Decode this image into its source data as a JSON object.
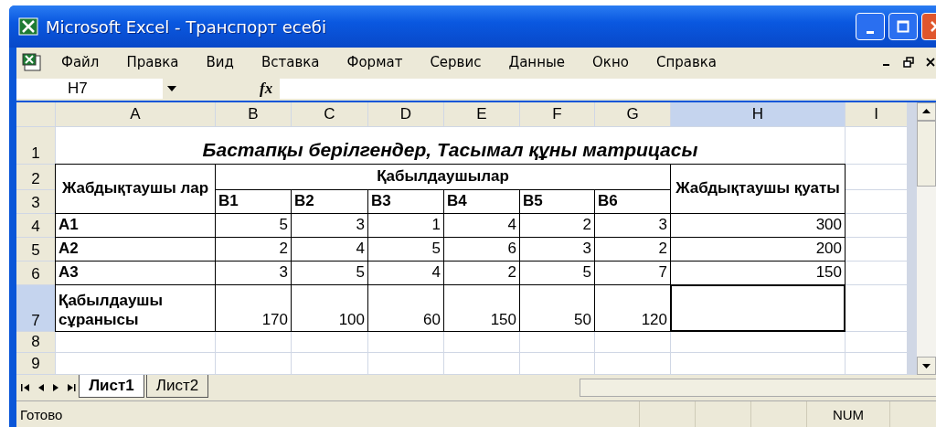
{
  "window": {
    "title": "Microsoft Excel - Транспорт есебі"
  },
  "menu": [
    "Файл",
    "Правка",
    "Вид",
    "Вставка",
    "Формат",
    "Сервис",
    "Данные",
    "Окно",
    "Справка"
  ],
  "formula_bar": {
    "name_box": "H7",
    "fx_label": "fx"
  },
  "column_headers": [
    {
      "label": "A",
      "selected": false
    },
    {
      "label": "B",
      "selected": false
    },
    {
      "label": "C",
      "selected": false
    },
    {
      "label": "D",
      "selected": false
    },
    {
      "label": "E",
      "selected": false
    },
    {
      "label": "F",
      "selected": false
    },
    {
      "label": "G",
      "selected": false
    },
    {
      "label": "H",
      "selected": true
    },
    {
      "label": "I",
      "selected": false
    }
  ],
  "row_headers": [
    {
      "label": "1",
      "selected": false
    },
    {
      "label": "2",
      "selected": false
    },
    {
      "label": "3",
      "selected": false
    },
    {
      "label": "4",
      "selected": false
    },
    {
      "label": "5",
      "selected": false
    },
    {
      "label": "6",
      "selected": false
    },
    {
      "label": "7",
      "selected": true
    },
    {
      "label": "8",
      "selected": false
    },
    {
      "label": "9",
      "selected": false
    }
  ],
  "table": {
    "title": "Бастапқы берілгендер, Тасымал құны матрицасы",
    "supplier_header": "Жабдықтаушы лар",
    "receivers_header": "Қабылдаушылар",
    "capacity_header": "Жабдықтаушы қуаты",
    "receivers": [
      "B1",
      "B2",
      "B3",
      "B4",
      "B5",
      "B6"
    ],
    "suppliers": [
      {
        "name": "A1",
        "costs": [
          "5",
          "3",
          "1",
          "4",
          "2",
          "3"
        ],
        "capacity": "300"
      },
      {
        "name": "A2",
        "costs": [
          "2",
          "4",
          "5",
          "6",
          "3",
          "2"
        ],
        "capacity": "200"
      },
      {
        "name": "A3",
        "costs": [
          "3",
          "5",
          "4",
          "2",
          "5",
          "7"
        ],
        "capacity": "150"
      }
    ],
    "demand": {
      "label": "Қабылдаушы сұранысы",
      "values": [
        "170",
        "100",
        "60",
        "150",
        "50",
        "120"
      ]
    }
  },
  "sheet_tabs": [
    {
      "label": "Лист1",
      "selected": true
    },
    {
      "label": "Лист2",
      "selected": false
    }
  ],
  "status_bar": {
    "status": "Готово",
    "num": "NUM"
  }
}
